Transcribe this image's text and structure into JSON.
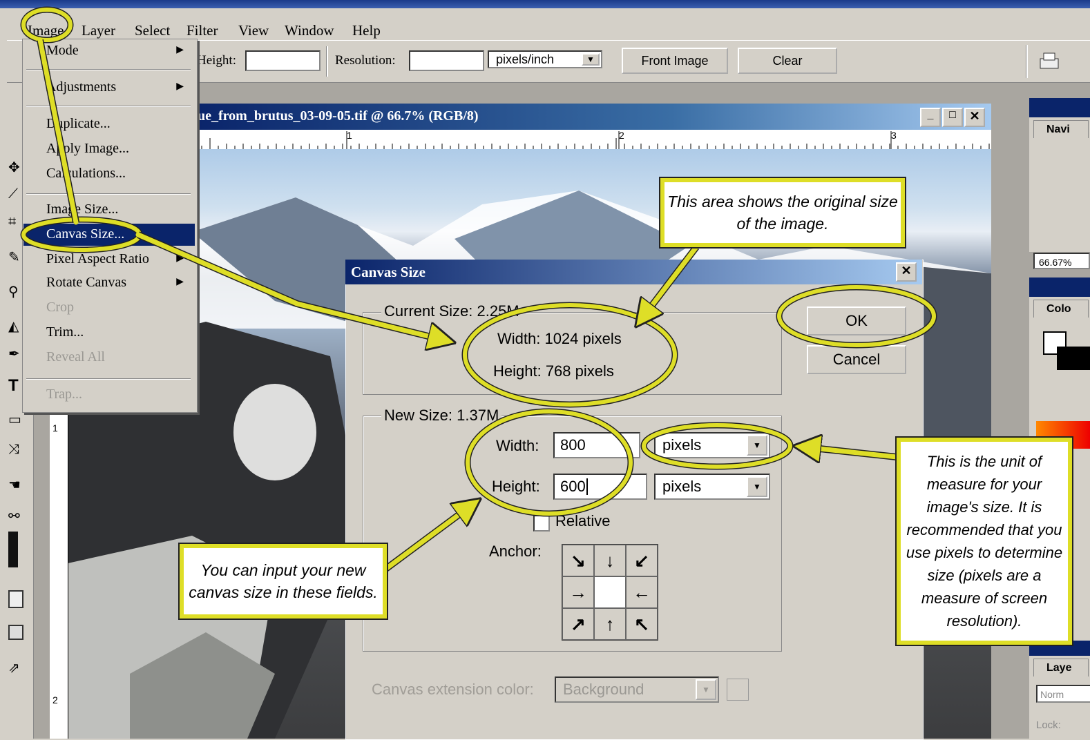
{
  "menubar": {
    "items": [
      "Image",
      "Layer",
      "Select",
      "Filter",
      "View",
      "Window",
      "Help"
    ]
  },
  "options_bar": {
    "height_label": "Height:",
    "resolution_label": "Resolution:",
    "resolution_unit": "pixels/inch",
    "front_image_label": "Front Image",
    "clear_label": "Clear"
  },
  "document": {
    "title": "ue_from_brutus_03-09-05.tif @ 66.7% (RGB/8)",
    "ruler_top_marks": [
      "1",
      "2",
      "3"
    ],
    "ruler_left_marks": [
      "1",
      "2"
    ]
  },
  "image_menu": {
    "items": [
      {
        "label": "Mode",
        "submenu": true,
        "enabled": true
      },
      {
        "label": "Adjustments",
        "submenu": true,
        "enabled": true
      },
      {
        "label": "Duplicate...",
        "submenu": false,
        "enabled": true
      },
      {
        "label": "Apply Image...",
        "submenu": false,
        "enabled": true
      },
      {
        "label": "Calculations...",
        "submenu": false,
        "enabled": true
      },
      {
        "label": "Image Size...",
        "submenu": false,
        "enabled": true
      },
      {
        "label": "Canvas Size...",
        "submenu": false,
        "enabled": true,
        "selected": true
      },
      {
        "label": "Pixel Aspect Ratio",
        "submenu": true,
        "enabled": true
      },
      {
        "label": "Rotate Canvas",
        "submenu": true,
        "enabled": true
      },
      {
        "label": "Crop",
        "submenu": false,
        "enabled": false
      },
      {
        "label": "Trim...",
        "submenu": false,
        "enabled": true
      },
      {
        "label": "Reveal All",
        "submenu": false,
        "enabled": false
      },
      {
        "label": "Trap...",
        "submenu": false,
        "enabled": false
      }
    ]
  },
  "dialog": {
    "title": "Canvas Size",
    "current_size_label": "Current Size: 2.25M",
    "current_width": "Width:  1024 pixels",
    "current_height": "Height:  768 pixels",
    "new_size_label": "New Size: 1.37M",
    "width_label": "Width:",
    "width_value": "800",
    "width_unit": "pixels",
    "height_label": "Height:",
    "height_value": "600",
    "height_unit": "pixels",
    "relative_label": "Relative",
    "relative_checked": false,
    "anchor_label": "Anchor:",
    "anchor_arrows": [
      "↘",
      "↓",
      "↙",
      "→",
      "",
      "←",
      "↗",
      "↑",
      "↖"
    ],
    "extension_label": "Canvas extension color:",
    "extension_value": "Background",
    "ok_label": "OK",
    "cancel_label": "Cancel"
  },
  "right_panels": {
    "navigator_tab": "Navi",
    "zoom_value": "66.67%",
    "color_tab": "Colo",
    "layers_tab": "Laye",
    "blend_mode": "Norm",
    "lock_label": "Lock:"
  },
  "callouts": {
    "original_size": "This area shows the original size of the image.",
    "input_fields": "You can input your new canvas size in these fields.",
    "unit_of_measure": "This is the unit of measure for your image's size.  It is recommended that you use pixels to determine size (pixels are a measure of screen resolution)."
  },
  "colors": {
    "highlight_yellow": "#dede27",
    "title_blue": "#0a246a",
    "menu_selected": "#0a246a",
    "window_gray": "#d4d0c8"
  }
}
